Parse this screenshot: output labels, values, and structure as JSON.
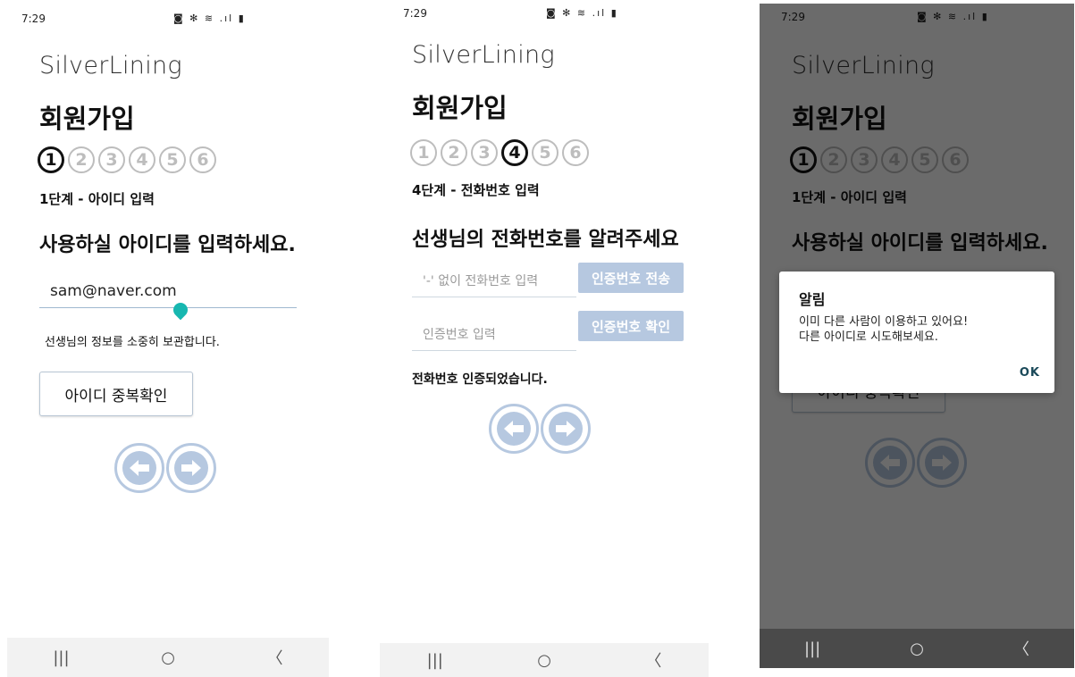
{
  "status": {
    "time": "7:29",
    "notif_icons": "▣ ● ⚘",
    "sys_icons": "◙ ✻ ≋ .ıl ▮"
  },
  "app": {
    "brand": "SilverLining",
    "title": "회원가입"
  },
  "steps": [
    "1",
    "2",
    "3",
    "4",
    "5",
    "6"
  ],
  "screen1": {
    "step_label": "1단계 - 아이디 입력",
    "question": "사용하실 아이디를 입력하세요.",
    "id_value": "sam@naver.com",
    "note": "선생님의 정보를 소중히 보관합니다.",
    "dup_check_label": "아이디 중복확인",
    "active_step": 1
  },
  "screen2": {
    "step_label": "4단계 - 전화번호 입력",
    "question": "선생님의 전화번호를 알려주세요",
    "phone_placeholder": "'-' 없이 전화번호 입력",
    "send_code_label": "인증번호 전송",
    "code_placeholder": "인증번호 입력",
    "verify_code_label": "인증번호 확인",
    "note": "전화번호 인증되었습니다.",
    "active_step": 4
  },
  "dialog": {
    "title": "알림",
    "message_line1": "이미 다른 사람이 이용하고 있어요!",
    "message_line2": "다른 아이디로 시도해보세요.",
    "ok_label": "OK"
  },
  "nav": {
    "recent": "|||",
    "home": "○",
    "back": "〈"
  },
  "colors": {
    "accent": "#b6c8e0",
    "cursor": "#17b7b0",
    "text": "#111111"
  }
}
